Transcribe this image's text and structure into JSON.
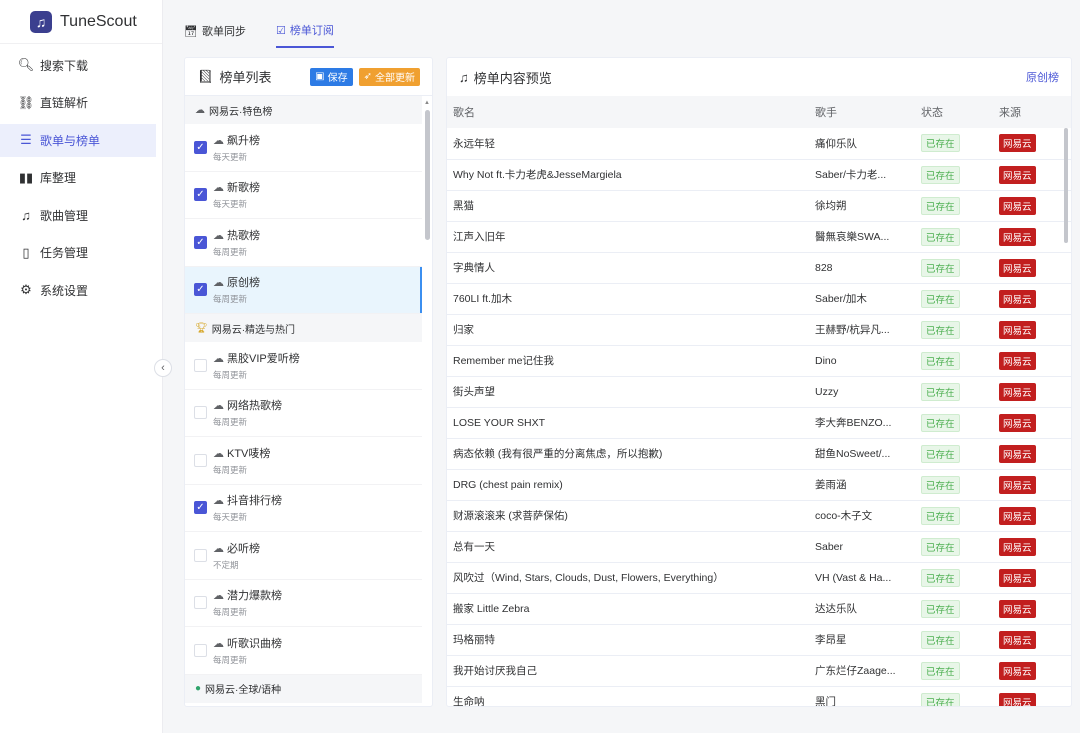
{
  "app": {
    "name": "TuneScout"
  },
  "nav": [
    {
      "label": "搜索下载",
      "icon": "search-icon",
      "glyph": "🔍︎"
    },
    {
      "label": "直链解析",
      "icon": "link-icon",
      "glyph": "⛓"
    },
    {
      "label": "歌单与榜单",
      "icon": "list-icon",
      "glyph": "☰",
      "active": true
    },
    {
      "label": "库整理",
      "icon": "library-icon",
      "glyph": "▮▮"
    },
    {
      "label": "歌曲管理",
      "icon": "music-note-icon",
      "glyph": "♫"
    },
    {
      "label": "任务管理",
      "icon": "clipboard-icon",
      "glyph": "▯"
    },
    {
      "label": "系统设置",
      "icon": "gear-icon",
      "glyph": "⚙"
    }
  ],
  "tabs": [
    {
      "label": "歌单同步",
      "icon": "calendar-icon"
    },
    {
      "label": "榜单订阅",
      "icon": "checklist-icon",
      "active": true
    }
  ],
  "left": {
    "title": "榜单列表",
    "save_label": "保存",
    "update_label": "全部更新",
    "groups": [
      {
        "title": "网易云·特色榜",
        "icon": "cloud-icon",
        "items": [
          {
            "name": "飙升榜",
            "freq": "每天更新",
            "checked": true
          },
          {
            "name": "新歌榜",
            "freq": "每天更新",
            "checked": true
          },
          {
            "name": "热歌榜",
            "freq": "每周更新",
            "checked": true
          },
          {
            "name": "原创榜",
            "freq": "每周更新",
            "checked": true,
            "selected": true
          }
        ]
      },
      {
        "title": "网易云·精选与热门",
        "icon": "trophy-icon",
        "items": [
          {
            "name": "黑胶VIP爱听榜",
            "freq": "每周更新",
            "checked": false
          },
          {
            "name": "网络热歌榜",
            "freq": "每周更新",
            "checked": false
          },
          {
            "name": "KTV唛榜",
            "freq": "每周更新",
            "checked": false
          },
          {
            "name": "抖音排行榜",
            "freq": "每天更新",
            "checked": true
          },
          {
            "name": "必听榜",
            "freq": "不定期",
            "checked": false
          },
          {
            "name": "潜力爆款榜",
            "freq": "每周更新",
            "checked": false
          },
          {
            "name": "听歌识曲榜",
            "freq": "每周更新",
            "checked": false
          }
        ]
      },
      {
        "title": "网易云·全球/语种",
        "icon": "globe-icon",
        "items": []
      }
    ]
  },
  "right": {
    "title": "榜单内容预览",
    "link": "原创榜",
    "columns": [
      "歌名",
      "歌手",
      "状态",
      "来源"
    ],
    "rows": [
      [
        "永远年轻",
        "痛仰乐队",
        "已存在",
        "网易云"
      ],
      [
        "Why Not ft.卡力老虎&JesseMargiela",
        "Saber/卡力老...",
        "已存在",
        "网易云"
      ],
      [
        "黑猫",
        "徐均朔",
        "已存在",
        "网易云"
      ],
      [
        "江声入旧年",
        "醫無哀樂SWA...",
        "已存在",
        "网易云"
      ],
      [
        "字典情人",
        "828",
        "已存在",
        "网易云"
      ],
      [
        "760LI ft.加木",
        "Saber/加木",
        "已存在",
        "网易云"
      ],
      [
        "归家",
        "王赫野/杭异凡...",
        "已存在",
        "网易云"
      ],
      [
        "Remember me记住我",
        "Dino",
        "已存在",
        "网易云"
      ],
      [
        "街头声望",
        "Uzzy",
        "已存在",
        "网易云"
      ],
      [
        "LOSE YOUR SHXT",
        "李大奔BENZO...",
        "已存在",
        "网易云"
      ],
      [
        "病态依赖 (我有很严重的分离焦虑，所以抱歉)",
        "甜鱼NoSweet/...",
        "已存在",
        "网易云"
      ],
      [
        "DRG (chest pain remix)",
        "姜雨涵",
        "已存在",
        "网易云"
      ],
      [
        "财源滚滚来 (求菩萨保佑)",
        "coco-木子文",
        "已存在",
        "网易云"
      ],
      [
        "总有一天",
        "Saber",
        "已存在",
        "网易云"
      ],
      [
        "风吹过（Wind, Stars, Clouds, Dust, Flowers, Everything）",
        "VH (Vast & Ha...",
        "已存在",
        "网易云"
      ],
      [
        "搬家 Little Zebra",
        "达达乐队",
        "已存在",
        "网易云"
      ],
      [
        "玛格丽特",
        "李昂星",
        "已存在",
        "网易云"
      ],
      [
        "我开始讨厌我自己",
        "广东烂仔Zaage...",
        "已存在",
        "网易云"
      ],
      [
        "生命呐",
        "黑门",
        "已存在",
        "网易云"
      ]
    ]
  },
  "colors": {
    "accent": "#4a56d6",
    "source_tag": "#c21f1f",
    "status_ok": "#4caf50"
  }
}
